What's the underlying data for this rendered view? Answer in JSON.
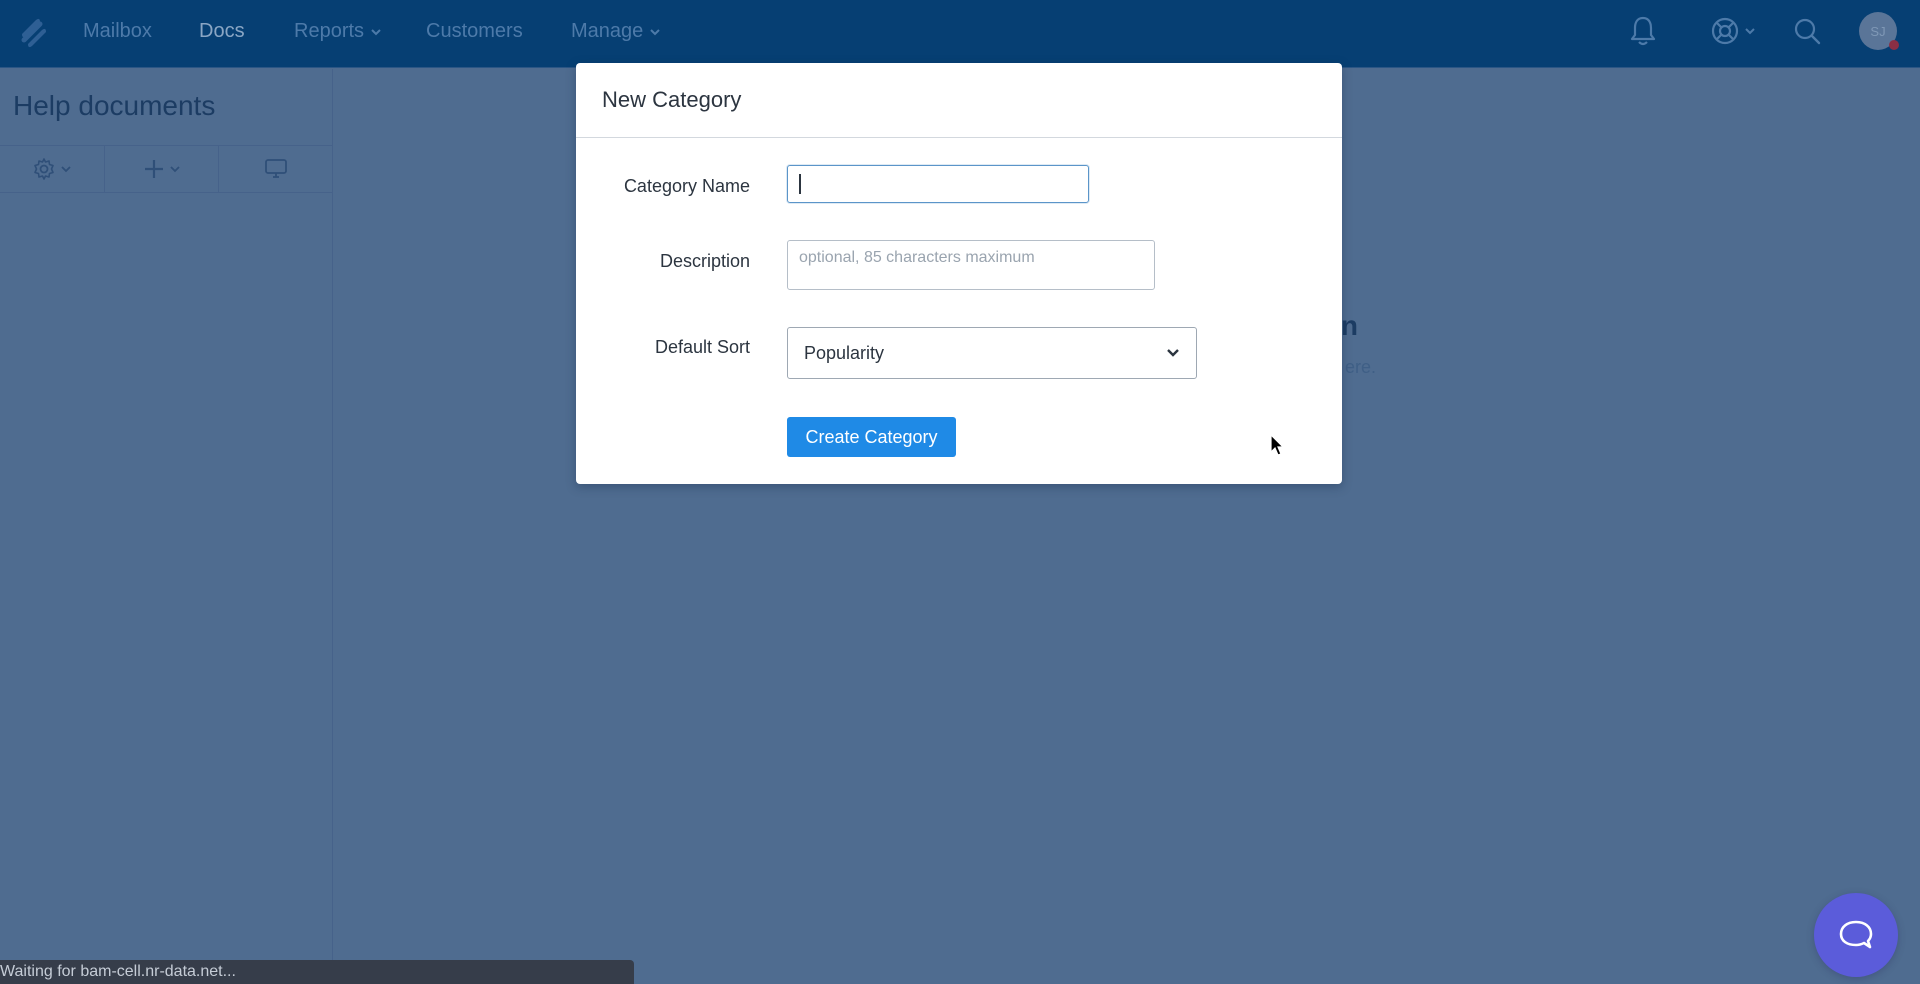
{
  "nav": {
    "items": [
      {
        "label": "Mailbox",
        "has_dropdown": false,
        "active": false
      },
      {
        "label": "Docs",
        "has_dropdown": false,
        "active": true
      },
      {
        "label": "Reports",
        "has_dropdown": true,
        "active": false
      },
      {
        "label": "Customers",
        "has_dropdown": false,
        "active": false
      },
      {
        "label": "Manage",
        "has_dropdown": true,
        "active": false
      }
    ],
    "right_icons": [
      "bell-icon",
      "help-lifebuoy-icon",
      "search-icon"
    ],
    "avatar_initials": "SJ"
  },
  "sidebar": {
    "title": "Help documents",
    "toolbar": [
      {
        "icon": "gear-icon",
        "has_dropdown": true
      },
      {
        "icon": "plus-icon",
        "has_dropdown": true
      },
      {
        "icon": "monitor-icon",
        "has_dropdown": false
      }
    ]
  },
  "background": {
    "empty_title_fragment": "n",
    "empty_subtitle_fragment": "ere."
  },
  "modal": {
    "title": "New Category",
    "fields": {
      "category_name": {
        "label": "Category Name",
        "value": "",
        "placeholder": ""
      },
      "description": {
        "label": "Description",
        "value": "",
        "placeholder": "optional, 85 characters maximum"
      },
      "default_sort": {
        "label": "Default Sort",
        "selected": "Popularity"
      }
    },
    "submit_label": "Create Category"
  },
  "status_bar": {
    "text": "Waiting for bam-cell.nr-data.net..."
  },
  "colors": {
    "nav_bg": "#063f73",
    "overlay_bg": "#4f6c90",
    "primary_button": "#1f8ae6",
    "beacon": "#5b5cda"
  }
}
